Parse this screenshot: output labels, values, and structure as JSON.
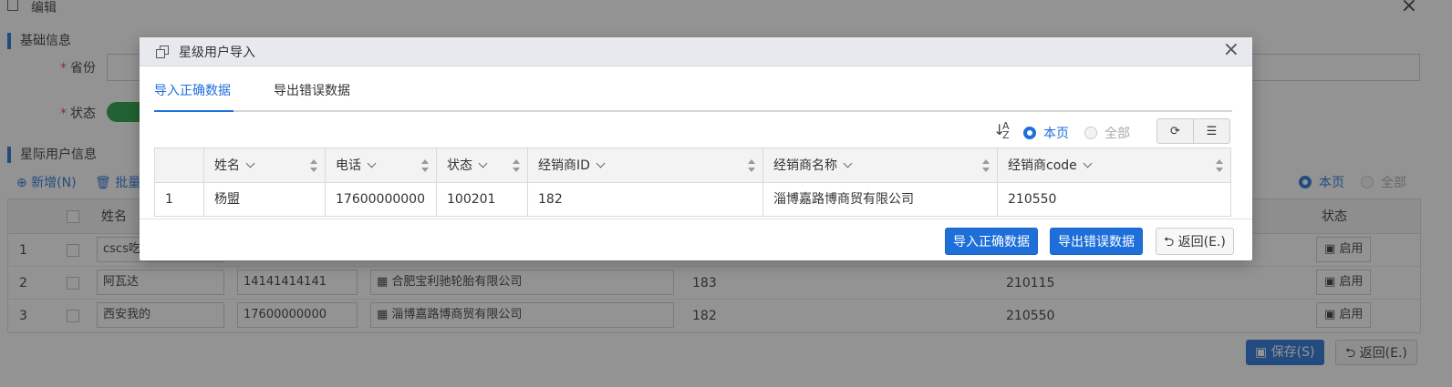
{
  "background": {
    "window_title": "编辑",
    "section_basic": "基础信息",
    "province_label": "省份",
    "status_label": "状态",
    "section_users": "星际用户信息",
    "add_label": "⊕ 新增(N)",
    "batch_label": "🗑 批量",
    "radio_page": "本页",
    "radio_all": "全部",
    "col_name": "姓名",
    "col_status": "状态",
    "rows": [
      {
        "no": "1",
        "name": "cscs吃",
        "phone": "",
        "dealer": "",
        "dealer_id": "",
        "code": "",
        "status": "启用"
      },
      {
        "no": "2",
        "name": "阿瓦达",
        "phone": "14141414141",
        "dealer": "合肥宝利驰轮胎有限公司",
        "dealer_id": "183",
        "code": "210115",
        "status": "启用"
      },
      {
        "no": "3",
        "name": "西安我的",
        "phone": "17600000000",
        "dealer": "淄博嘉路博商贸有限公司",
        "dealer_id": "182",
        "code": "210550",
        "status": "启用"
      }
    ],
    "save_label": "保存(S)",
    "back_label": "返回(E.)"
  },
  "modal": {
    "title": "星级用户导入",
    "close": "×",
    "tabs": [
      {
        "label": "导入正确数据"
      },
      {
        "label": "导出错误数据"
      }
    ],
    "toolbar": {
      "radio_page": "本页",
      "radio_all": "全部",
      "sort_icon_top": "A",
      "sort_icon_bottom": "Z"
    },
    "columns": [
      "姓名",
      "电话",
      "状态",
      "经销商ID",
      "经销商名称",
      "经销商code"
    ],
    "rows": [
      {
        "no": "1",
        "name": "杨盟",
        "phone": "17600000000",
        "status": "100201",
        "dealer_id": "182",
        "dealer_name": "淄博嘉路博商贸有限公司",
        "dealer_code": "210550"
      }
    ],
    "footer": {
      "import_label": "导入正确数据",
      "export_label": "导出错误数据",
      "back_label": "返回(E.)"
    }
  },
  "colors": {
    "primary": "#1e6fd9",
    "overlay": "rgba(40,40,40,0.5)",
    "toggle_on": "#1c9a3c",
    "required": "#e53935"
  }
}
